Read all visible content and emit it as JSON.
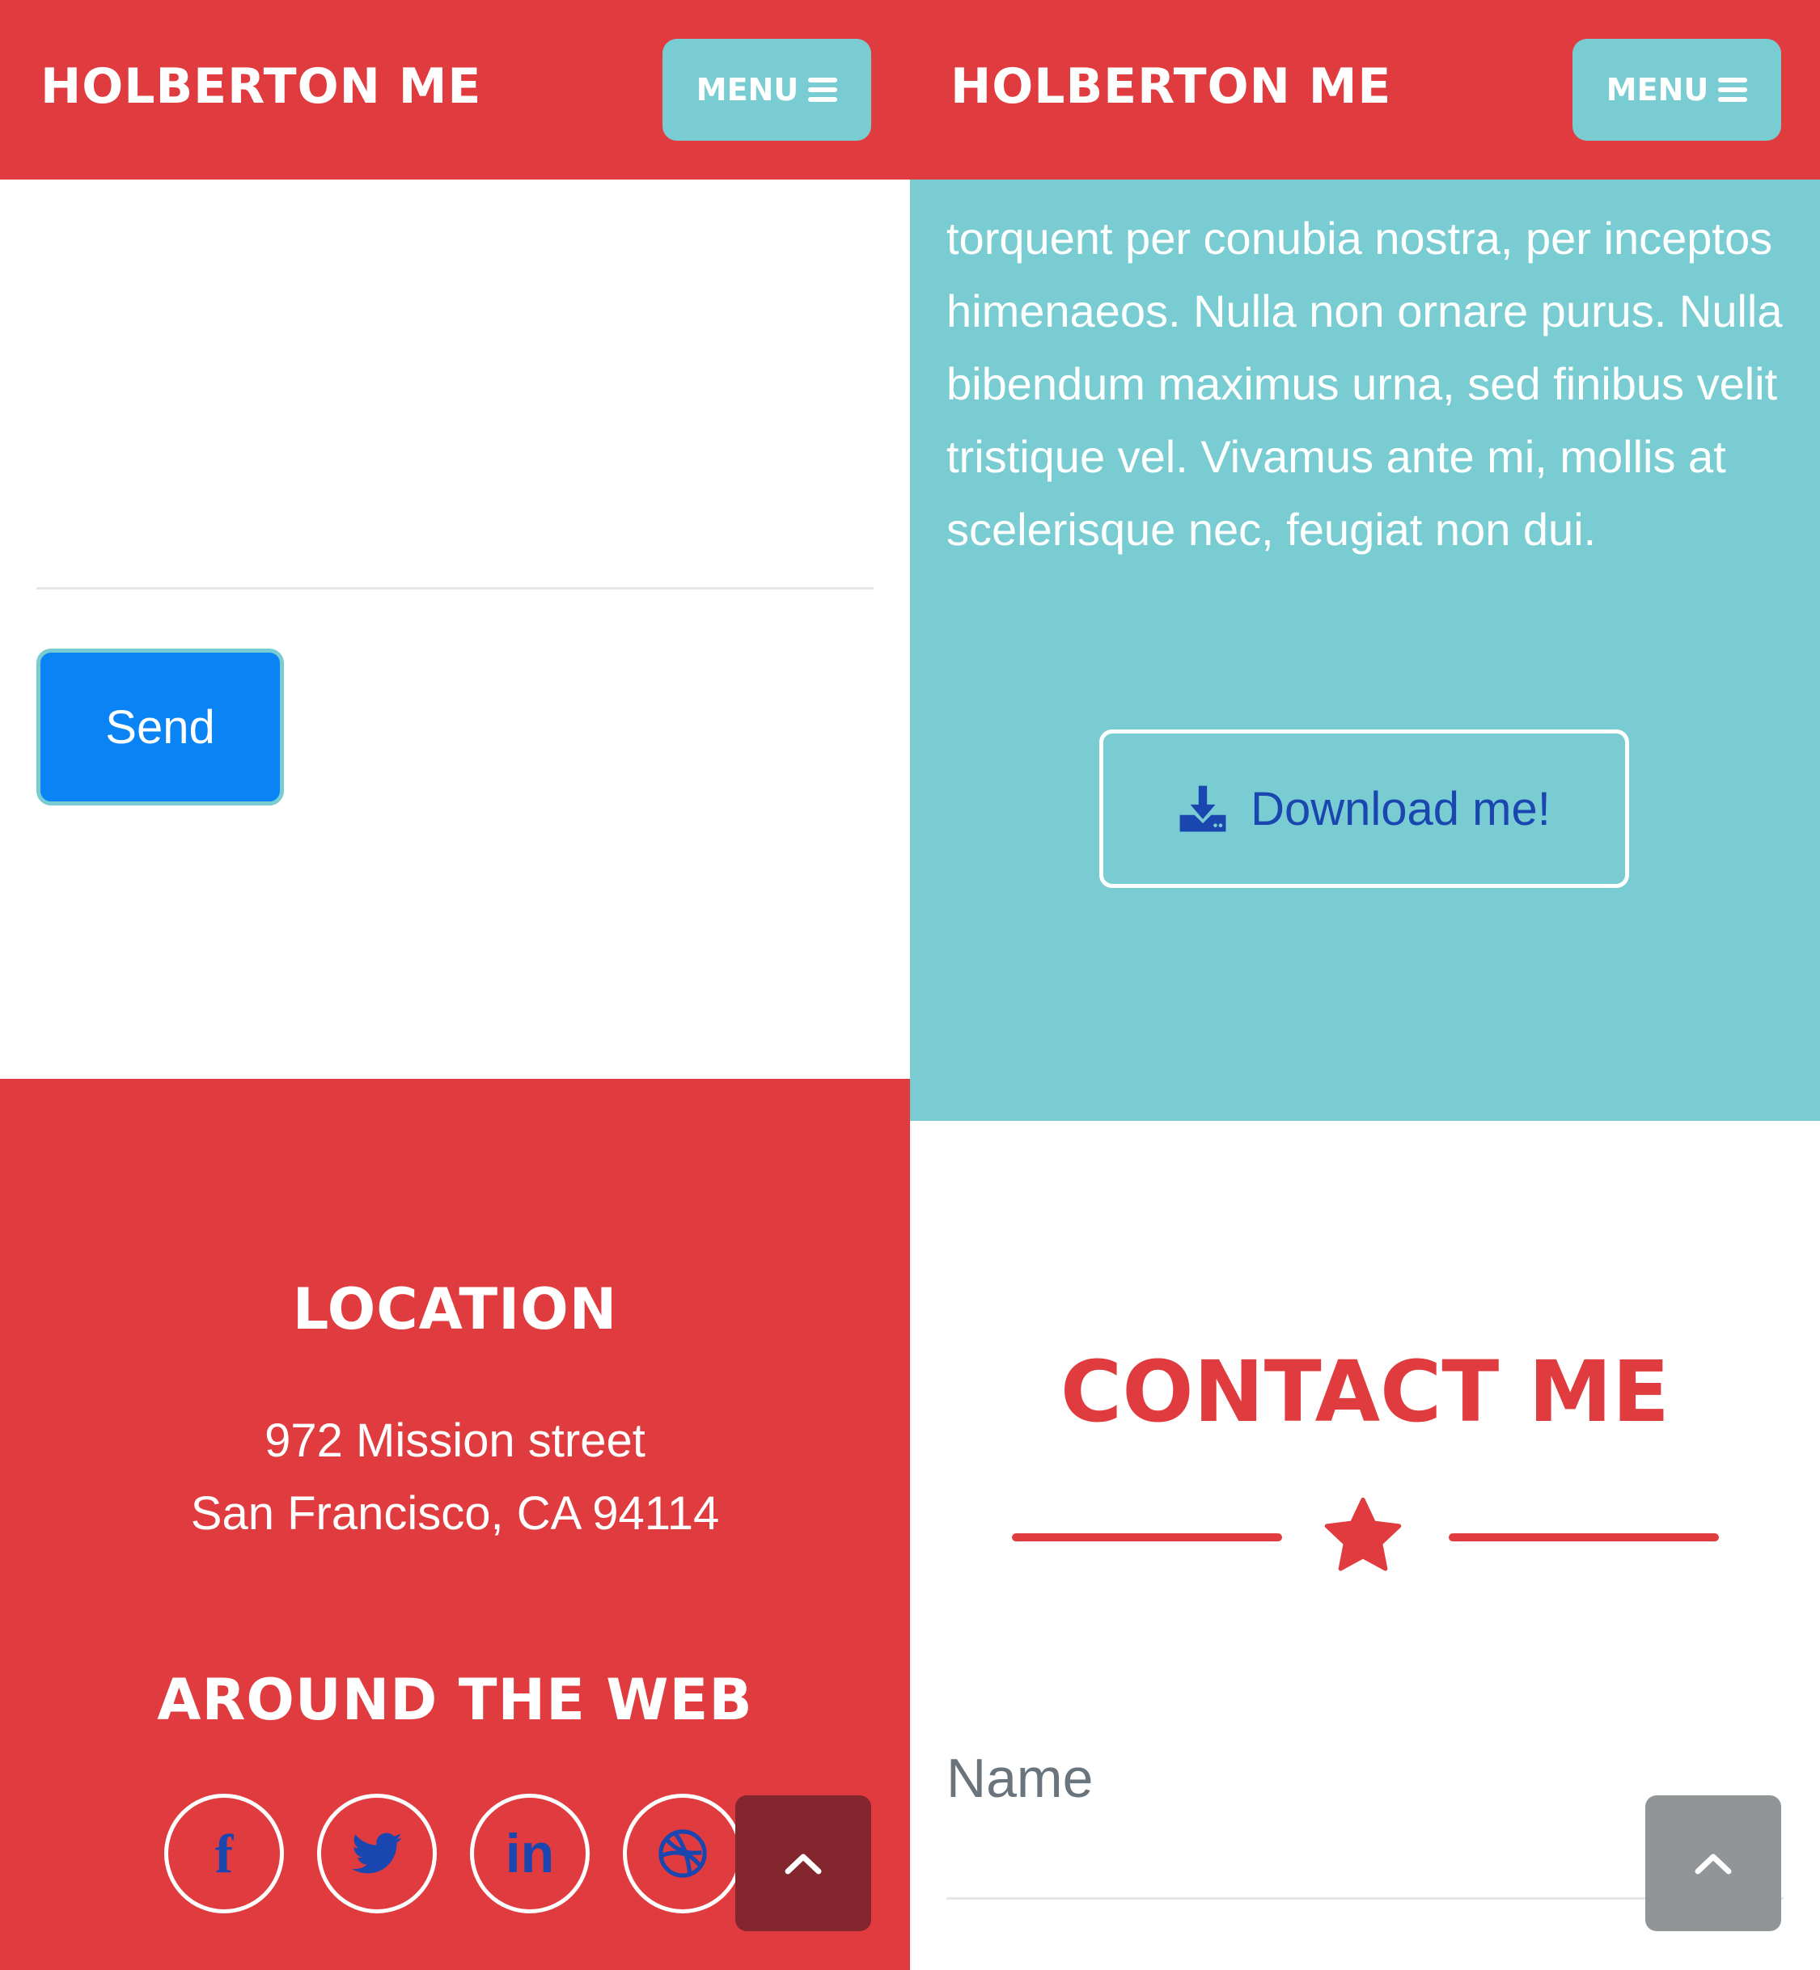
{
  "navbar": {
    "brand": "HOLBERTON ME",
    "menu_label": "MENU"
  },
  "left": {
    "form": {
      "send_label": "Send"
    },
    "footer": {
      "location_heading": "LOCATION",
      "address_line1": "972 Mission street",
      "address_line2": "San Francisco, CA 94114",
      "web_heading": "AROUND THE WEB",
      "social": [
        {
          "icon": "facebook-icon",
          "glyph": "f"
        },
        {
          "icon": "twitter-icon",
          "glyph": "twitter"
        },
        {
          "icon": "linkedin-icon",
          "glyph": "in"
        },
        {
          "icon": "dribbble-icon",
          "glyph": "dribbble"
        }
      ]
    }
  },
  "right": {
    "about_text": "torquent per conubia nostra, per inceptos himenaeos. Nulla non ornare purus. Nulla bibendum maximus urna, sed finibus velit tristique vel. Vivamus ante mi, mollis at scelerisque nec, feugiat non dui.",
    "download_label": "Download me!",
    "contact_title": "CONTACT ME",
    "name_placeholder": "Name"
  },
  "colors": {
    "primary_red": "#e03c3f",
    "teal": "#79cdd2",
    "link_blue": "#1a46b0",
    "send_blue": "#0a84f4",
    "scroll_dark": "#84262e",
    "scroll_gray": "#929597"
  }
}
